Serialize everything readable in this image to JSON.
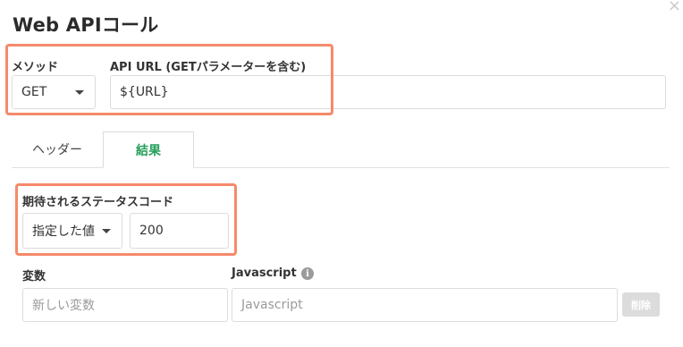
{
  "dialog": {
    "title": "Web APIコール",
    "close_label": "×"
  },
  "method": {
    "label": "メソッド",
    "value": "GET"
  },
  "url": {
    "label": "API URL (GETパラメーターを含む)",
    "value": "${URL}"
  },
  "tabs": [
    {
      "label": "ヘッダー",
      "active": false
    },
    {
      "label": "結果",
      "active": true
    }
  ],
  "status": {
    "label": "期待されるステータスコード",
    "mode_value": "指定した値",
    "code_value": "200"
  },
  "variable": {
    "label": "変数",
    "placeholder": "新しい変数"
  },
  "javascript": {
    "label": "Javascript",
    "info_icon": "i",
    "placeholder": "Javascript"
  },
  "delete_button": {
    "label": "削除"
  },
  "colors": {
    "highlight": "#f58a6b",
    "active_tab": "#27a05c"
  }
}
